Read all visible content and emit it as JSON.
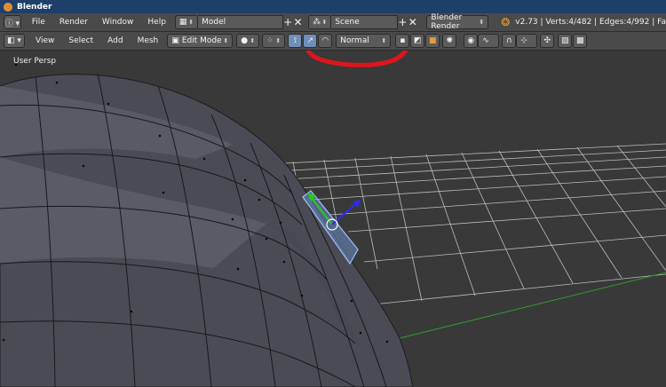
{
  "window": {
    "title": "Blender"
  },
  "info_header": {
    "menus": [
      "File",
      "Render",
      "Window",
      "Help"
    ],
    "screen_layout": "Model",
    "scene": "Scene",
    "render_engine": "Blender Render",
    "stats": "v2.73 | Verts:4/482 | Edges:4/992 | Fa"
  },
  "view3d_header": {
    "menus": [
      "View",
      "Select",
      "Add",
      "Mesh"
    ],
    "mode": "Edit Mode",
    "pivot_orientation": "Normal"
  },
  "viewport": {
    "label": "User Persp"
  },
  "colors": {
    "annotation": "#e0141c",
    "selection": "#7fa6e0",
    "grid": "#c8c8c8",
    "x_axis": "#2f9a2f",
    "widget_z": "#2a2aff",
    "widget_y": "#22cc22"
  },
  "icons": [
    "blender-logo-icon",
    "info-editor-icon",
    "view3d-editor-icon",
    "add-icon",
    "close-icon",
    "scene-icon",
    "shading-solid-icon",
    "pivot-icon",
    "manipulator-translate-icon",
    "manipulator-rotate-icon",
    "vertex-select-icon",
    "edge-select-icon",
    "face-select-icon",
    "occlude-icon",
    "layer-icon",
    "proportional-icon",
    "snap-icon",
    "render-icon",
    "camera-icon"
  ]
}
